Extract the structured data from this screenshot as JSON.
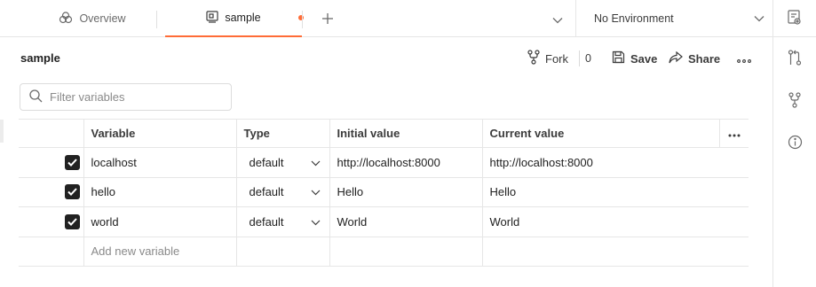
{
  "tabs": {
    "overview_label": "Overview",
    "sample_label": "sample"
  },
  "environment": {
    "selected": "No Environment"
  },
  "header": {
    "title": "sample",
    "fork_label": "Fork",
    "fork_count": "0",
    "save_label": "Save",
    "share_label": "Share"
  },
  "filter": {
    "placeholder": "Filter variables"
  },
  "table": {
    "columns": [
      "Variable",
      "Type",
      "Initial value",
      "Current value"
    ],
    "rows": [
      {
        "variable": "localhost",
        "type": "default",
        "initial": "http://localhost:8000",
        "current": "http://localhost:8000",
        "checked": true
      },
      {
        "variable": "hello",
        "type": "default",
        "initial": "Hello",
        "current": "Hello",
        "checked": true
      },
      {
        "variable": "world",
        "type": "default",
        "initial": "World",
        "current": "World",
        "checked": true
      }
    ],
    "add_placeholder": "Add new variable"
  },
  "colors": {
    "accent": "#ff6c37",
    "text": "#212121",
    "muted": "#6b6b6b",
    "border": "#e6e6e6"
  },
  "icons": {
    "overview": "overview-icon",
    "environment": "environment-icon",
    "add": "plus-icon",
    "fork": "fork-icon",
    "save": "save-icon",
    "share": "share-icon",
    "more": "more-horizontal-icon",
    "search": "search-icon",
    "pull_request": "pull-request-icon",
    "branch": "branch-icon",
    "info": "info-icon"
  }
}
